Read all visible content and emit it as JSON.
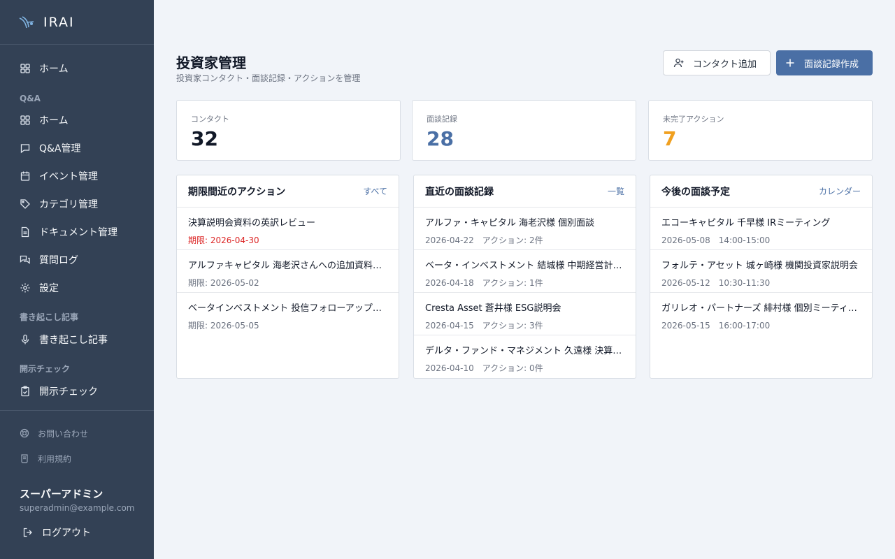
{
  "brand": {
    "name": "IRAI"
  },
  "sidebar": {
    "home": "ホーム",
    "qa_section": "Q&A",
    "qa_items": [
      "ホーム",
      "Q&A管理",
      "イベント管理",
      "カテゴリ管理",
      "ドキュメント管理",
      "質問ログ",
      "設定"
    ],
    "transcript_section": "書き起こし記事",
    "transcript_item": "書き起こし記事",
    "disclosure_section": "開示チェック",
    "disclosure_item": "開示チェック",
    "contact": "お問い合わせ",
    "terms": "利用規約",
    "user_name": "スーパーアドミン",
    "user_email": "superadmin@example.com",
    "logout": "ログアウト"
  },
  "header": {
    "title": "投資家管理",
    "subtitle": "投資家コンタクト・面談記録・アクションを管理",
    "add_contact": "コンタクト追加",
    "create_record": "面談記録作成"
  },
  "stats": [
    {
      "label": "コンタクト",
      "value": "32",
      "color": "#111827"
    },
    {
      "label": "面談記録",
      "value": "28",
      "color": "#4a6fa5"
    },
    {
      "label": "未完了アクション",
      "value": "7",
      "color": "#f0a020"
    }
  ],
  "panels": {
    "actions": {
      "title": "期限間近のアクション",
      "link": "すべて",
      "rows": [
        {
          "title": "決算説明会資料の英訳レビュー",
          "meta": "期限: 2026-04-30"
        },
        {
          "title": "アルファキャピタル 海老沢さんへの追加資料送付",
          "meta": "期限: 2026-05-02"
        },
        {
          "title": "ベータインベストメント 投信フォローアップ連絡",
          "meta": "期限: 2026-05-05"
        }
      ]
    },
    "recent": {
      "title": "直近の面談記録",
      "link": "一覧",
      "rows": [
        {
          "title": "アルファ・キャピタル 海老沢様 個別面談",
          "meta": "2026-04-22　アクション: 2件"
        },
        {
          "title": "ベータ・インベストメント 結城様 中期経営計画説明",
          "meta": "2026-04-18　アクション: 1件"
        },
        {
          "title": "Cresta Asset 蒼井様 ESG説明会",
          "meta": "2026-04-15　アクション: 3件"
        },
        {
          "title": "デルタ・ファンド・マネジメント 久遠様 決算説明",
          "meta": "2026-04-10　アクション: 0件"
        }
      ]
    },
    "upcoming": {
      "title": "今後の面談予定",
      "link": "カレンダー",
      "rows": [
        {
          "title": "エコーキャピタル 千早様 IRミーティング",
          "meta": "2026-05-08　14:00-15:00"
        },
        {
          "title": "フォルテ・アセット 城ヶ崎様 機関投資家説明会",
          "meta": "2026-05-12　10:30-11:30"
        },
        {
          "title": "ガリレオ・パートナーズ 緋村様 個別ミーティング",
          "meta": "2026-05-15　16:00-17:00"
        }
      ]
    }
  }
}
